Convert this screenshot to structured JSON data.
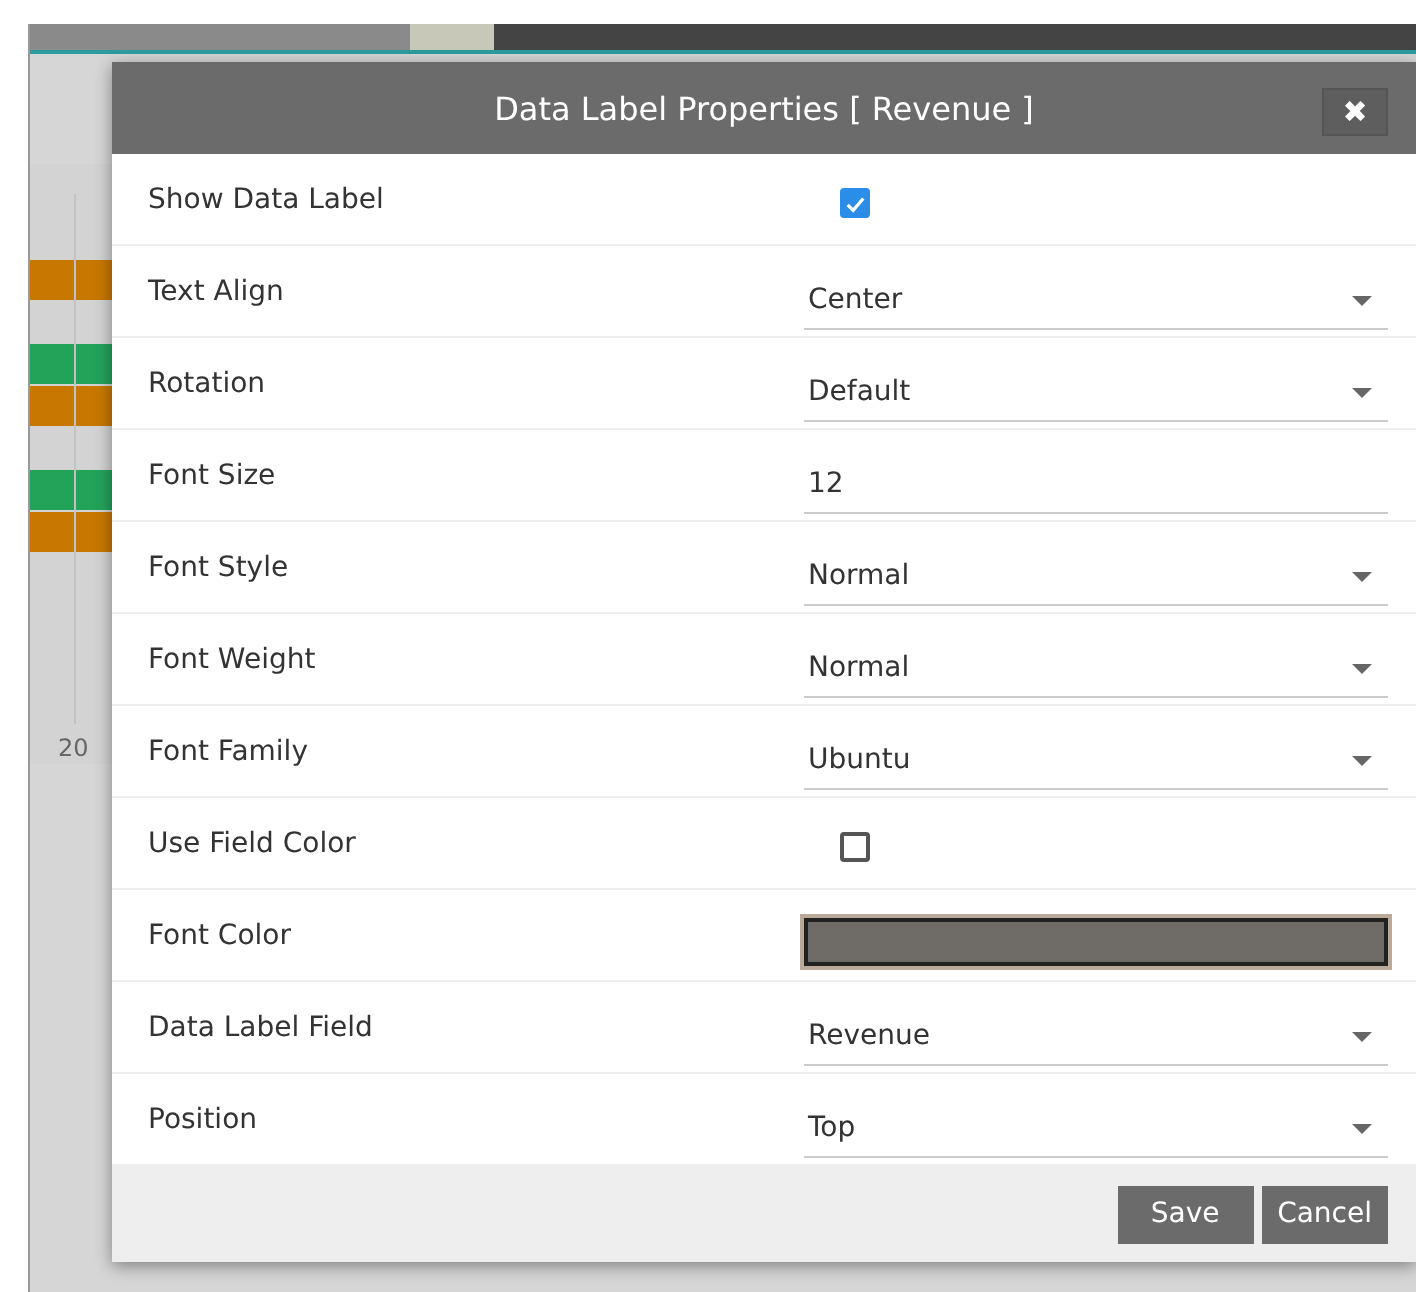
{
  "background": {
    "axis_label": "20"
  },
  "dialog": {
    "title": "Data Label Properties [ Revenue ]",
    "close": "✖",
    "rows": [
      {
        "label": "Show Data Label",
        "kind": "checkbox",
        "checked": true
      },
      {
        "label": "Text Align",
        "kind": "select",
        "value": "Center"
      },
      {
        "label": "Rotation",
        "kind": "select",
        "value": "Default"
      },
      {
        "label": "Font Size",
        "kind": "text",
        "value": "12"
      },
      {
        "label": "Font Style",
        "kind": "select",
        "value": "Normal"
      },
      {
        "label": "Font Weight",
        "kind": "select",
        "value": "Normal"
      },
      {
        "label": "Font Family",
        "kind": "select",
        "value": "Ubuntu"
      },
      {
        "label": "Use Field Color",
        "kind": "checkbox",
        "checked": false
      },
      {
        "label": "Font Color",
        "kind": "color",
        "color": "#6f6b66"
      },
      {
        "label": "Data Label Field",
        "kind": "select",
        "value": "Revenue"
      },
      {
        "label": "Position",
        "kind": "select",
        "value": "Top"
      }
    ],
    "buttons": [
      "Save",
      "Cancel"
    ]
  }
}
